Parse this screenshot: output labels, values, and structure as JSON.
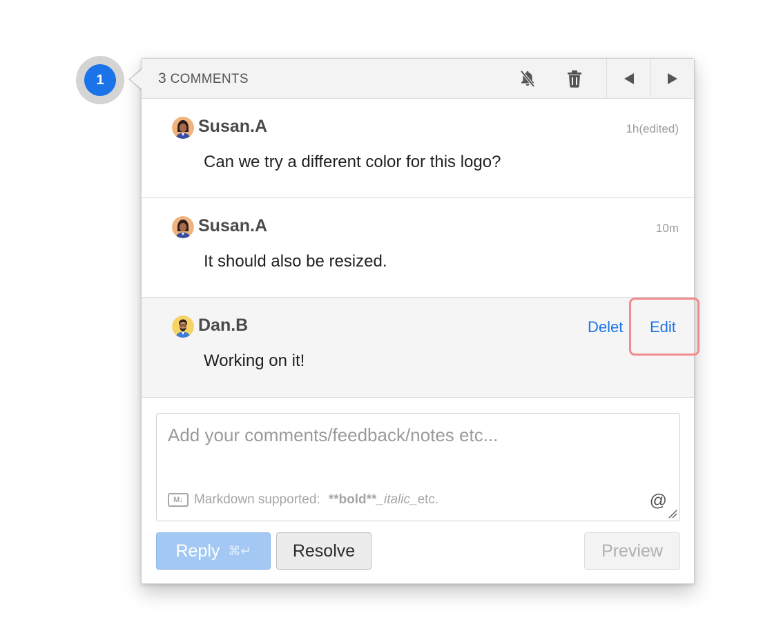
{
  "pin": {
    "number": "1"
  },
  "header": {
    "count": "3",
    "label": "COMMENTS",
    "icons": [
      "bell-mute-icon",
      "trash-icon",
      "prev-arrow-icon",
      "next-arrow-icon"
    ]
  },
  "comments": [
    {
      "author": "Susan.A",
      "time": "1h(edited)",
      "text": "Can we try a different color for this logo?",
      "avatar": "woman-avatar"
    },
    {
      "author": "Susan.A",
      "time": "10m",
      "text": "It should also be resized.",
      "avatar": "woman-avatar"
    },
    {
      "author": "Dan.B",
      "time": "",
      "text": "Working on it!",
      "avatar": "man-avatar",
      "actions": {
        "delete": "Delet",
        "edit": "Edit"
      }
    }
  ],
  "composer": {
    "placeholder": "Add your comments/feedback/notes etc...",
    "md_label": "Markdown supported:",
    "md_bold": "**bold**",
    "md_italic": "_italic_",
    "md_etc": "etc.",
    "md_icon_text": "M↓",
    "mention_symbol": "@"
  },
  "buttons": {
    "reply": "Reply",
    "reply_shortcut": "⌘↵",
    "resolve": "Resolve",
    "preview": "Preview"
  },
  "colors": {
    "accent": "#1a73e8",
    "highlight": "#f28b8b",
    "reply_disabled": "#a3c8f3"
  }
}
